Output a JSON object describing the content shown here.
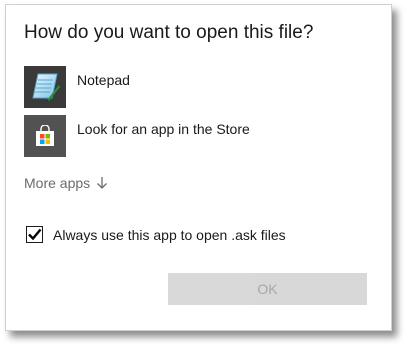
{
  "dialog": {
    "title": "How do you want to open this file?",
    "apps": [
      {
        "label": "Notepad",
        "icon": "notepad-icon"
      },
      {
        "label": "Look for an app in the Store",
        "icon": "store-icon"
      }
    ],
    "more_apps_label": "More apps",
    "more_apps_icon": "arrow-down-icon",
    "always_use_label": "Always use this app to open .ask files",
    "always_use_checked": true,
    "ok_label": "OK",
    "ok_enabled": false
  },
  "colors": {
    "tile_notepad": "#3a3a3a",
    "tile_store": "#525252",
    "ok_disabled_bg": "#cccccc",
    "ok_disabled_text": "#8a8a8a",
    "more_apps_text": "#6b6b6b"
  }
}
